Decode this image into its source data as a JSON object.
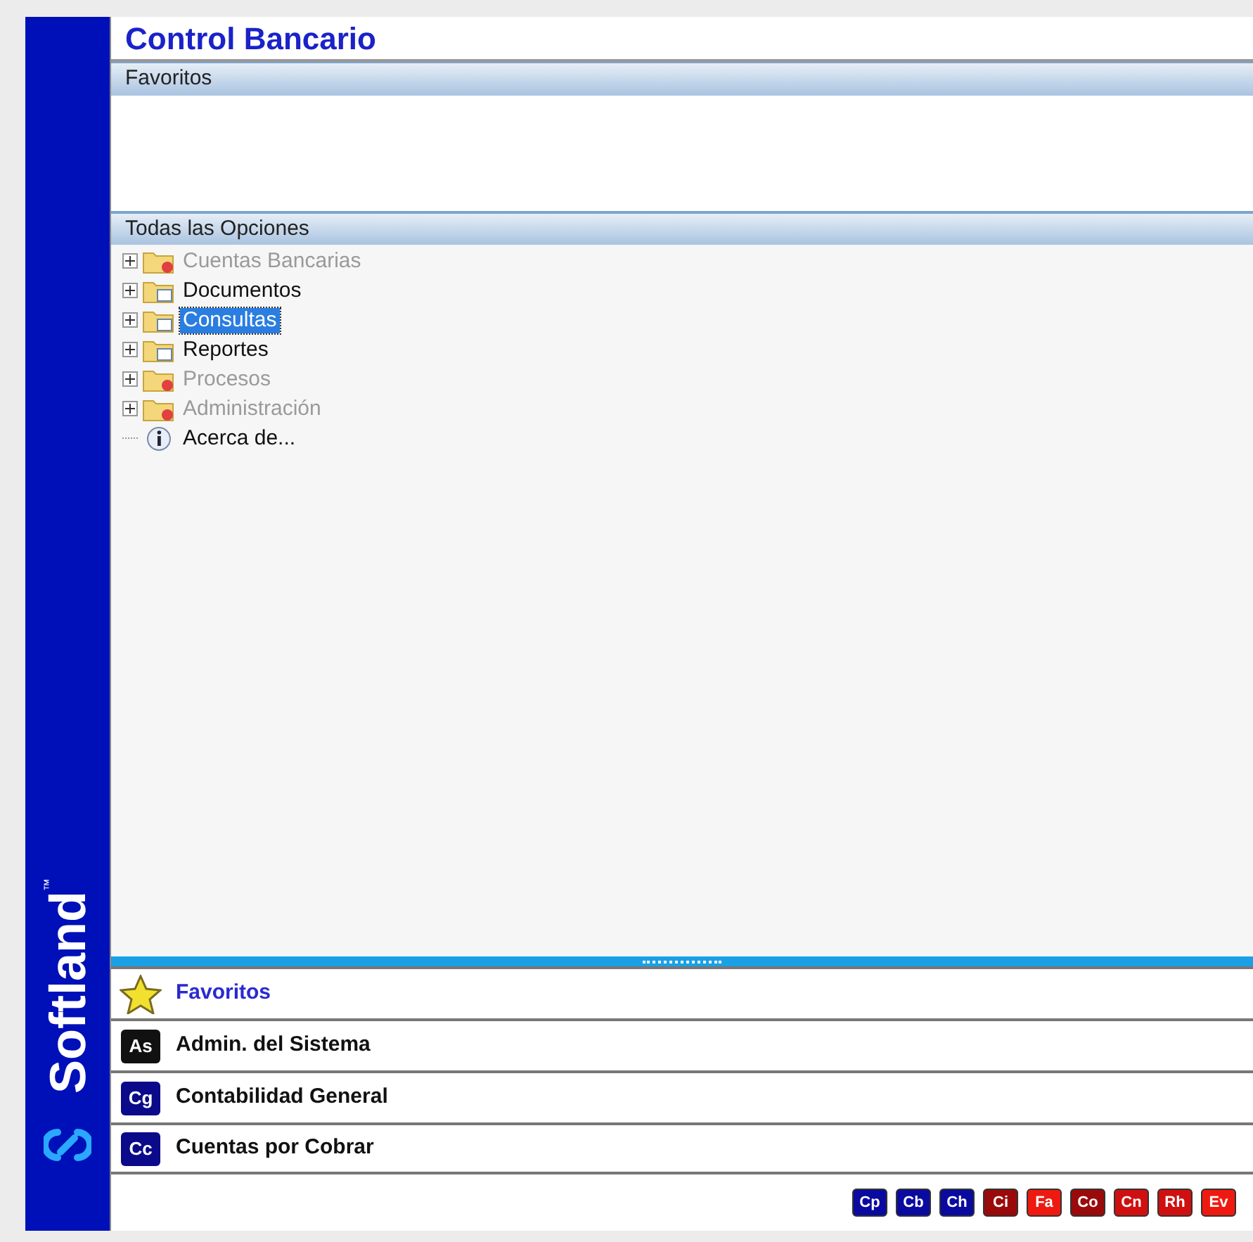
{
  "app_title": "Control Bancario",
  "favorites_panel": {
    "header": "Favoritos"
  },
  "options_panel": {
    "header": "Todas las Opciones",
    "items": [
      {
        "label": "Cuentas Bancarias",
        "kind": "folder",
        "disabled": true,
        "selected": false
      },
      {
        "label": "Documentos",
        "kind": "folder",
        "disabled": false,
        "selected": false
      },
      {
        "label": "Consultas",
        "kind": "folder",
        "disabled": false,
        "selected": true
      },
      {
        "label": "Reportes",
        "kind": "folder",
        "disabled": false,
        "selected": false
      },
      {
        "label": "Procesos",
        "kind": "folder",
        "disabled": true,
        "selected": false
      },
      {
        "label": "Administración",
        "kind": "folder",
        "disabled": true,
        "selected": false
      },
      {
        "label": "Acerca de...",
        "kind": "info",
        "disabled": false,
        "selected": false
      }
    ]
  },
  "nav_buttons": [
    {
      "label": "Favoritos",
      "kind": "favorites",
      "selected": true
    },
    {
      "label": "Admin. del Sistema",
      "kind": "module",
      "badge": "As",
      "color": "#111111",
      "selected": false
    },
    {
      "label": "Contabilidad General",
      "kind": "module",
      "badge": "Cg",
      "color": "#0a0a8a",
      "selected": false
    },
    {
      "label": "Cuentas por Cobrar",
      "kind": "module",
      "badge": "Cc",
      "color": "#0a0a8a",
      "selected": false
    }
  ],
  "module_badges": [
    {
      "label": "Cp",
      "color": "#0a0aa0"
    },
    {
      "label": "Cb",
      "color": "#0a0aa0"
    },
    {
      "label": "Ch",
      "color": "#0a0aa0"
    },
    {
      "label": "Ci",
      "color": "#9a0a0a"
    },
    {
      "label": "Fa",
      "color": "#ee1a10"
    },
    {
      "label": "Co",
      "color": "#9a0a0a"
    },
    {
      "label": "Cn",
      "color": "#d01010"
    },
    {
      "label": "Rh",
      "color": "#d01010"
    },
    {
      "label": "Ev",
      "color": "#ee1a10"
    }
  ],
  "brand": {
    "name": "Softland",
    "mark": "™"
  }
}
